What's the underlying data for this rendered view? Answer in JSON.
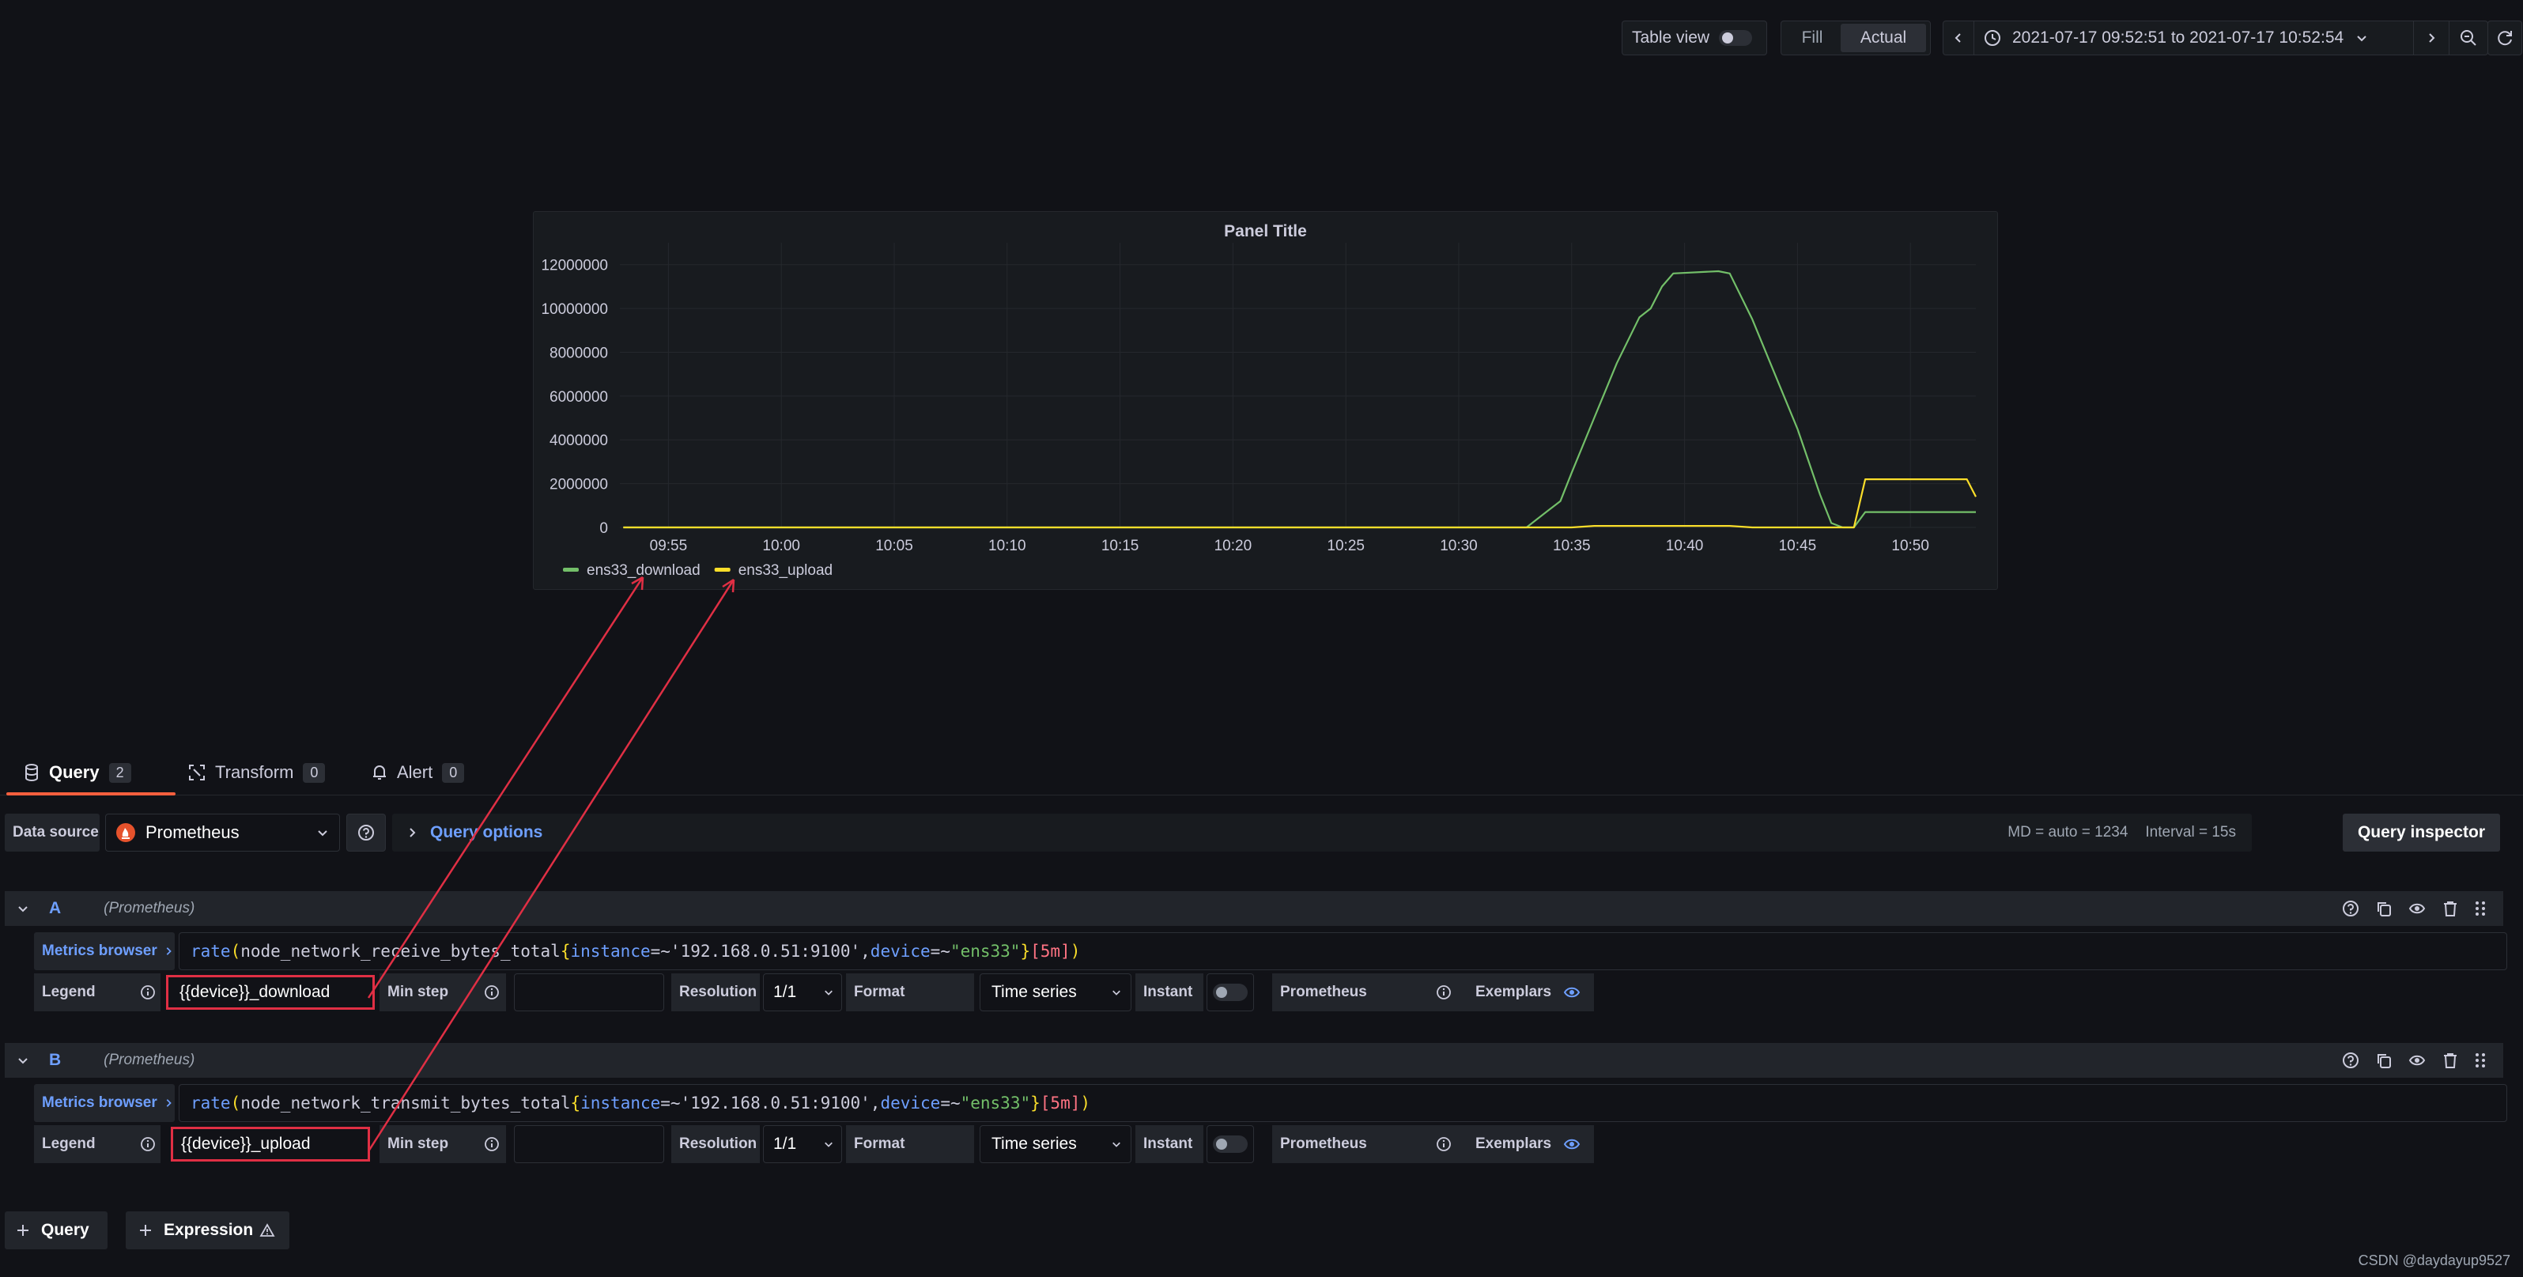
{
  "toolbar": {
    "table_view_label": "Table view",
    "fill_label": "Fill",
    "actual_label": "Actual",
    "time_range": "2021-07-17 09:52:51 to 2021-07-17 10:52:54"
  },
  "panel": {
    "title": "Panel Title",
    "y_ticks": [
      "12000000",
      "10000000",
      "8000000",
      "6000000",
      "4000000",
      "2000000",
      "0"
    ],
    "x_ticks": [
      "09:55",
      "10:00",
      "10:05",
      "10:10",
      "10:15",
      "10:20",
      "10:25",
      "10:30",
      "10:35",
      "10:40",
      "10:45",
      "10:50"
    ],
    "legend": [
      {
        "label": "ens33_download",
        "color": "#73bf69"
      },
      {
        "label": "ens33_upload",
        "color": "#fade2a"
      }
    ]
  },
  "chart_data": {
    "type": "line",
    "title": "Panel Title",
    "ylim": [
      0,
      13000000
    ],
    "x_range": [
      "09:52:51",
      "10:52:54"
    ],
    "series": [
      {
        "name": "ens33_download",
        "color": "#73bf69",
        "points": [
          [
            "09:53",
            0
          ],
          [
            "10:33",
            0
          ],
          [
            "10:33:30",
            400000
          ],
          [
            "10:34",
            800000
          ],
          [
            "10:34:30",
            1200000
          ],
          [
            "10:35",
            2500000
          ],
          [
            "10:36",
            5000000
          ],
          [
            "10:37",
            7500000
          ],
          [
            "10:38",
            9600000
          ],
          [
            "10:38:30",
            10000000
          ],
          [
            "10:39",
            11000000
          ],
          [
            "10:39:30",
            11600000
          ],
          [
            "10:41:30",
            11700000
          ],
          [
            "10:42",
            11600000
          ],
          [
            "10:43",
            9500000
          ],
          [
            "10:44",
            7000000
          ],
          [
            "10:45",
            4500000
          ],
          [
            "10:46",
            1500000
          ],
          [
            "10:46:30",
            200000
          ],
          [
            "10:47",
            0
          ],
          [
            "10:47:30",
            0
          ],
          [
            "10:48",
            700000
          ],
          [
            "10:52:54",
            700000
          ]
        ]
      },
      {
        "name": "ens33_upload",
        "color": "#fade2a",
        "points": [
          [
            "09:53",
            0
          ],
          [
            "10:35",
            0
          ],
          [
            "10:36",
            70000
          ],
          [
            "10:42",
            70000
          ],
          [
            "10:43",
            0
          ],
          [
            "10:47:30",
            0
          ],
          [
            "10:48",
            2200000
          ],
          [
            "10:52:30",
            2200000
          ],
          [
            "10:52:54",
            1400000
          ]
        ]
      }
    ]
  },
  "tabs": [
    {
      "label": "Query",
      "count": "2"
    },
    {
      "label": "Transform",
      "count": "0"
    },
    {
      "label": "Alert",
      "count": "0"
    }
  ],
  "datasource": {
    "label": "Data source",
    "value": "Prometheus",
    "query_options": "Query options",
    "md": "MD = auto = 1234",
    "interval": "Interval = 15s",
    "inspector": "Query inspector"
  },
  "queries": [
    {
      "letter": "A",
      "source": "(Prometheus)",
      "metrics_browser": "Metrics browser",
      "expr": {
        "fn": "rate",
        "metric": "node_network_receive_bytes_total",
        "k1": "instance",
        "op1": "=~",
        "v1": "'192.168.0.51:9100'",
        "k2": "device",
        "op2": "=~",
        "v2": "\"ens33\"",
        "range": "[5m]"
      },
      "legend_label": "Legend",
      "legend_value": "{{device}}_download",
      "min_step_label": "Min step",
      "resolution_label": "Resolution",
      "resolution_value": "1/1",
      "format_label": "Format",
      "format_value": "Time series",
      "instant_label": "Instant",
      "prometheus_label": "Prometheus",
      "exemplars_label": "Exemplars"
    },
    {
      "letter": "B",
      "source": "(Prometheus)",
      "metrics_browser": "Metrics browser",
      "expr": {
        "fn": "rate",
        "metric": "node_network_transmit_bytes_total",
        "k1": "instance",
        "op1": "=~",
        "v1": "'192.168.0.51:9100'",
        "k2": "device",
        "op2": "=~",
        "v2": "\"ens33\"",
        "range": "[5m]"
      },
      "legend_label": "Legend",
      "legend_value": "{{device}}_upload",
      "min_step_label": "Min step",
      "resolution_label": "Resolution",
      "resolution_value": "1/1",
      "format_label": "Format",
      "format_value": "Time series",
      "instant_label": "Instant",
      "prometheus_label": "Prometheus",
      "exemplars_label": "Exemplars"
    }
  ],
  "add_query_label": "Query",
  "add_expression_label": "Expression",
  "watermark": "CSDN @daydayup9527"
}
